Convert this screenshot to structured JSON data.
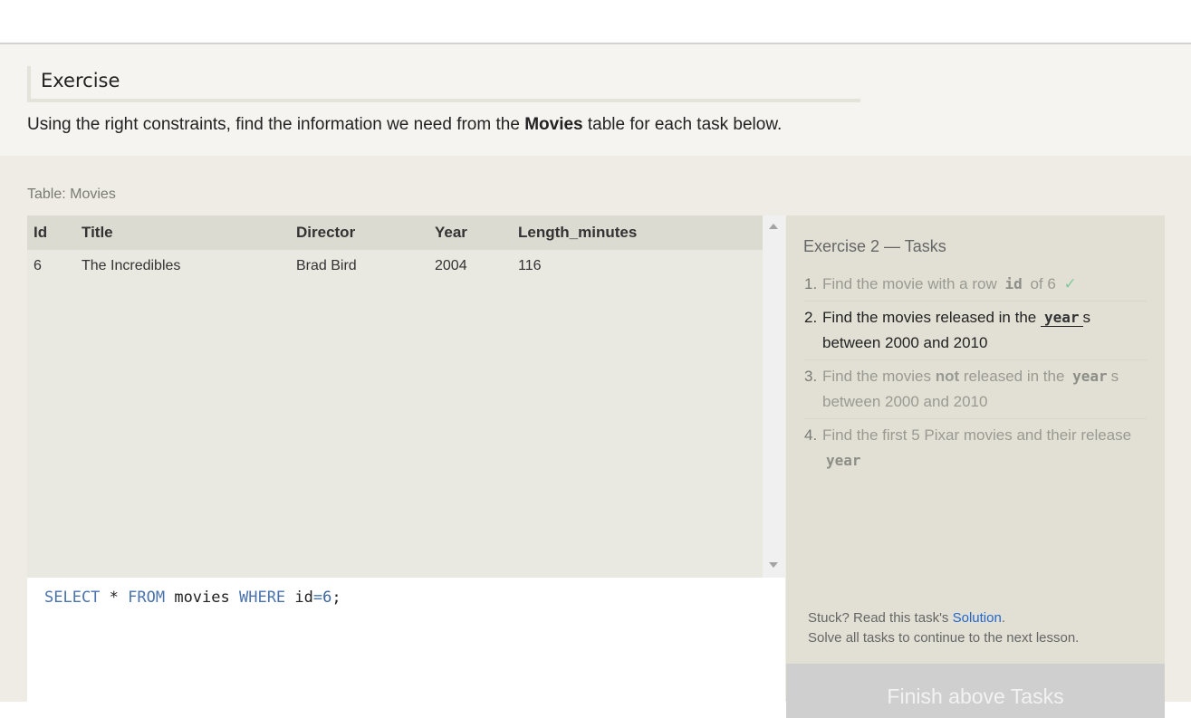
{
  "exercise": {
    "title": "Exercise",
    "intro_before": "Using the right constraints, find the information we need from the ",
    "intro_bold": "Movies",
    "intro_after": " table for each task below."
  },
  "table": {
    "label": "Table: Movies",
    "columns": [
      "Id",
      "Title",
      "Director",
      "Year",
      "Length_minutes"
    ],
    "rows": [
      [
        "6",
        "The Incredibles",
        "Brad Bird",
        "2004",
        "116"
      ]
    ]
  },
  "editor": {
    "query_tokens": [
      {
        "text": "SELECT",
        "type": "keyword"
      },
      {
        "text": " * ",
        "type": "plain"
      },
      {
        "text": "FROM",
        "type": "keyword"
      },
      {
        "text": " movies ",
        "type": "plain"
      },
      {
        "text": "WHERE",
        "type": "keyword"
      },
      {
        "text": " id",
        "type": "plain"
      },
      {
        "text": "=",
        "type": "keyword"
      },
      {
        "text": "6",
        "type": "number"
      },
      {
        "text": ";",
        "type": "plain"
      }
    ]
  },
  "tasks": {
    "title": "Exercise 2 — Tasks",
    "items": [
      {
        "num": "1.",
        "state": "done",
        "parts": [
          {
            "t": "Find the movie with a row "
          },
          {
            "t": "id",
            "code": true
          },
          {
            "t": " of 6 "
          }
        ],
        "check": "✓"
      },
      {
        "num": "2.",
        "state": "active",
        "parts": [
          {
            "t": "Find the movies released in the "
          },
          {
            "t": "year",
            "code": true
          },
          {
            "t": "s between 2000 and 2010"
          }
        ]
      },
      {
        "num": "3.",
        "state": "todo",
        "parts": [
          {
            "t": "Find the movies "
          },
          {
            "t": "not",
            "bold": true
          },
          {
            "t": " released in the "
          },
          {
            "t": "year",
            "code": true
          },
          {
            "t": "s between 2000 and 2010"
          }
        ]
      },
      {
        "num": "4.",
        "state": "todo",
        "parts": [
          {
            "t": "Find the first 5 Pixar movies and their release "
          },
          {
            "t": "year",
            "code": true
          }
        ]
      }
    ],
    "stuck_prefix": "Stuck? Read this task's ",
    "solution_link": "Solution",
    "stuck_suffix": ".",
    "continue_text": "Solve all tasks to continue to the next lesson.",
    "finish_button": "Finish above Tasks"
  },
  "colors": {
    "keyword": "#4a73ad",
    "link": "#2266cc",
    "check": "#7fc99a"
  }
}
